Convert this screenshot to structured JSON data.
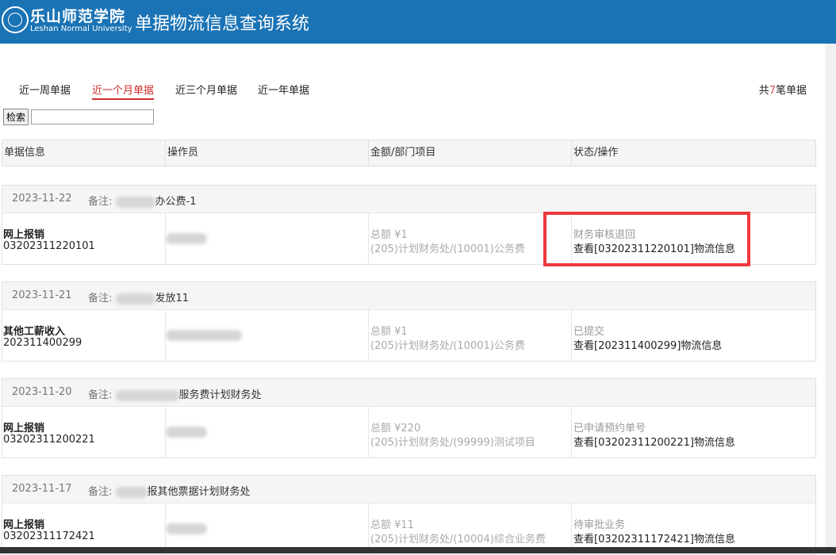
{
  "header": {
    "logo_cn": "乐山师范学院",
    "logo_en": "Leshan Normal University",
    "title": "单据物流信息查询系统"
  },
  "tabs": [
    {
      "label": "近一周单据",
      "active": false
    },
    {
      "label": "近一个月单据",
      "active": true
    },
    {
      "label": "近三个月单据",
      "active": false
    },
    {
      "label": "近一年单据",
      "active": false
    }
  ],
  "summary": {
    "prefix": "共",
    "count": "7",
    "suffix": "笔单据"
  },
  "search": {
    "button_label": "检索",
    "value": ""
  },
  "columns": [
    "单据信息",
    "操作员",
    "金额/部门项目",
    "状态/操作"
  ],
  "records": [
    {
      "date": "2023-11-22",
      "note_label": "备注:",
      "note_text": "办公费-1",
      "type": "网上报销",
      "doc_no": "03202311220101",
      "amount": "总额 ¥1",
      "dept": "(205)计划财务处/(10001)公务费",
      "status": "财务审核退回",
      "view": "查看[03202311220101]物流信息"
    },
    {
      "date": "2023-11-21",
      "note_label": "备注:",
      "note_text": "发放11",
      "type": "其他工薪收入",
      "doc_no": "202311400299",
      "amount": "总额 ¥1",
      "dept": "(205)计划财务处/(10001)公务费",
      "status": "已提交",
      "view": "查看[202311400299]物流信息"
    },
    {
      "date": "2023-11-20",
      "note_label": "备注:",
      "note_text": "服务费计划财务处",
      "type": "网上报销",
      "doc_no": "03202311200221",
      "amount": "总额 ¥220",
      "dept": "(205)计划财务处/(99999)测试项目",
      "status": "已申请预约单号",
      "view": "查看[03202311200221]物流信息"
    },
    {
      "date": "2023-11-17",
      "note_label": "备注:",
      "note_text": "报其他票据计划财务处",
      "type": "网上报销",
      "doc_no": "03202311172421",
      "amount": "总额 ¥11",
      "dept": "(205)计划财务处/(10004)综合业务费",
      "status": "待审批业务",
      "view": "查看[03202311172421]物流信息"
    }
  ],
  "colors": {
    "header_bg": "#1a73b5",
    "active_tab": "#c9302c",
    "count": "#d9534f",
    "highlight": "#f0383c"
  }
}
